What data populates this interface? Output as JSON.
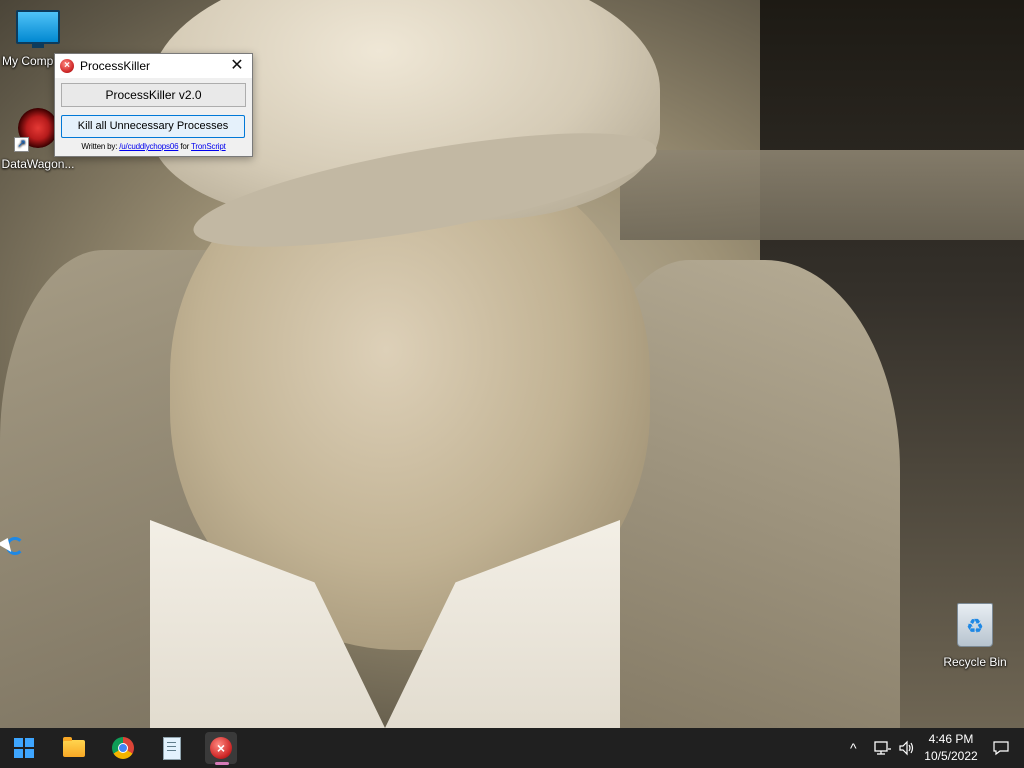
{
  "desktop": {
    "icons": [
      {
        "label": "My Comp",
        "icon": "monitor-icon"
      },
      {
        "label": "DataWagon...",
        "icon": "datawagon-icon"
      },
      {
        "label": "Recycle Bin",
        "icon": "recycle-bin-icon"
      }
    ]
  },
  "window": {
    "title": "ProcessKiller",
    "close_glyph": "✕",
    "banner": "ProcessKiller v2.0",
    "kill_button": "Kill all Unnecessary Processes",
    "footer": {
      "prefix": "Written by:",
      "author_link": "/u/cuddlychops06",
      "middle": "for",
      "project_link": "TronScript"
    }
  },
  "taskbar": {
    "items": [
      "start-icon",
      "file-explorer-icon",
      "chrome-icon",
      "notepad-icon",
      "processkiller-icon"
    ],
    "active_item": "processkiller-icon",
    "tray": {
      "chevron": "^",
      "time": "4:46 PM",
      "date": "10/5/2022"
    }
  },
  "colors": {
    "taskbar_bg": "#202020",
    "accent": "#0078d7",
    "start_blue": "#3ea6ff"
  }
}
